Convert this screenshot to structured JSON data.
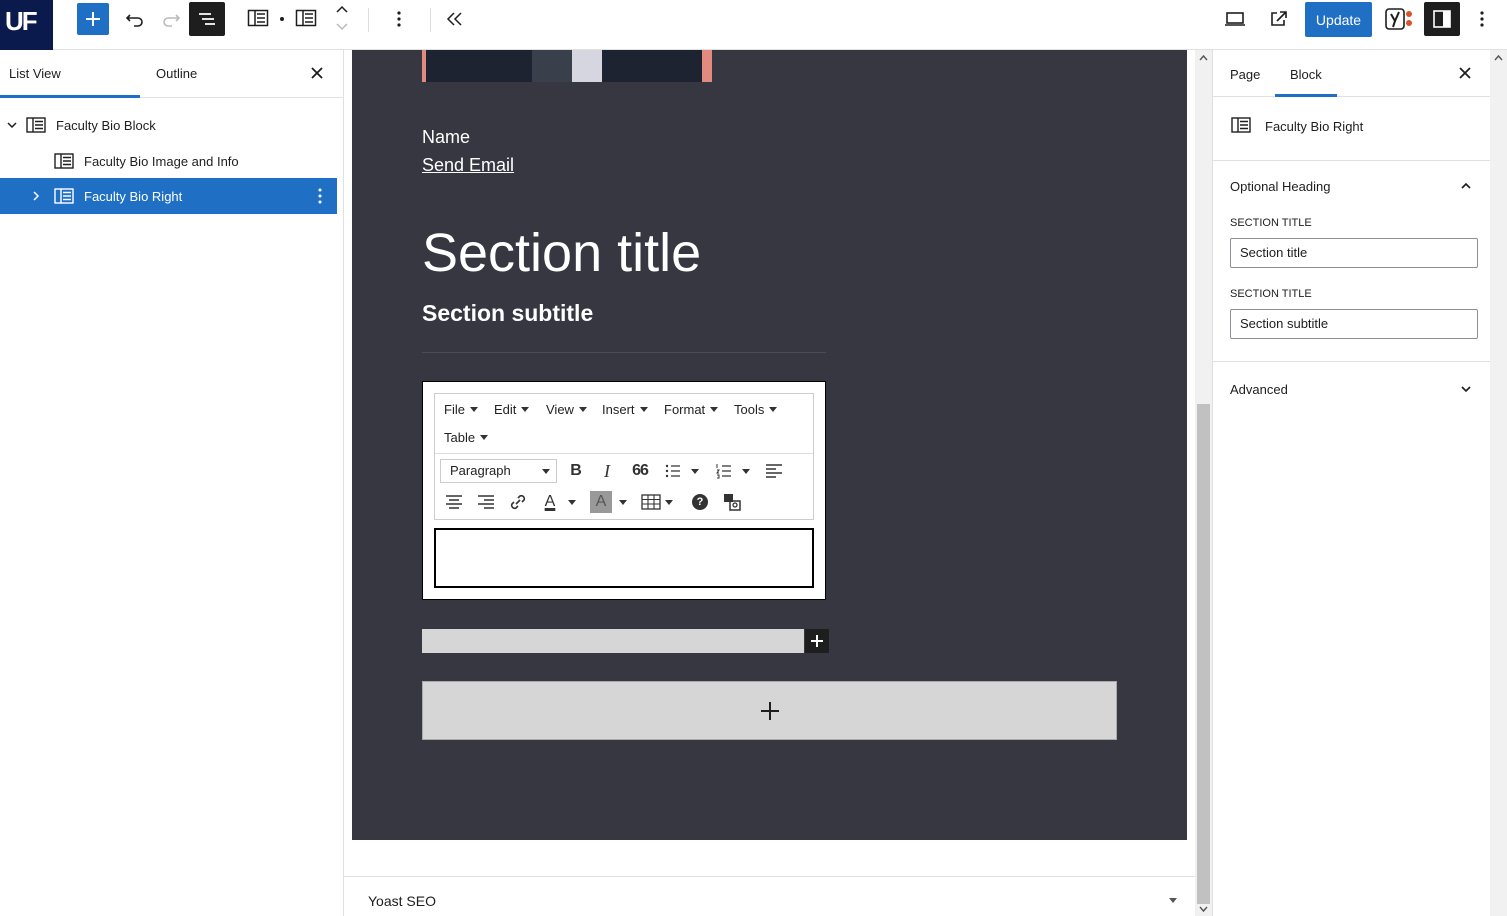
{
  "topbar": {
    "logo_text": "UF",
    "update_label": "Update",
    "colors": {
      "accent": "#1f6fc5",
      "logo_bg": "#0b1a4d",
      "dark": "#1e1e1e"
    }
  },
  "left_panel": {
    "tabs": [
      {
        "label": "List View"
      },
      {
        "label": "Outline"
      }
    ],
    "tree": [
      {
        "label": "Faculty Bio Block"
      },
      {
        "label": "Faculty Bio Image and Info"
      },
      {
        "label": "Faculty Bio Right"
      }
    ]
  },
  "canvas": {
    "name": "Name",
    "email_link": "Send Email",
    "section_title": "Section title",
    "section_subtitle": "Section subtitle",
    "bg_color": "#363740",
    "editor": {
      "menus": [
        {
          "label": "File"
        },
        {
          "label": "Edit"
        },
        {
          "label": "View"
        },
        {
          "label": "Insert"
        },
        {
          "label": "Format"
        },
        {
          "label": "Tools"
        },
        {
          "label": "Table"
        }
      ],
      "format_select": "Paragraph",
      "bold": "B",
      "italic": "I",
      "blockquote": "66",
      "text_color": "A",
      "bg_color": "A",
      "help": "?"
    }
  },
  "yoast": {
    "label": "Yoast SEO"
  },
  "right_panel": {
    "tabs": [
      {
        "label": "Page"
      },
      {
        "label": "Block"
      }
    ],
    "block_name": "Faculty Bio Right",
    "section_heading": "Optional Heading",
    "fields": [
      {
        "label": "SECTION TITLE",
        "value": "Section title"
      },
      {
        "label": "SECTION TITLE",
        "value": "Section subtitle"
      }
    ],
    "advanced": "Advanced"
  }
}
